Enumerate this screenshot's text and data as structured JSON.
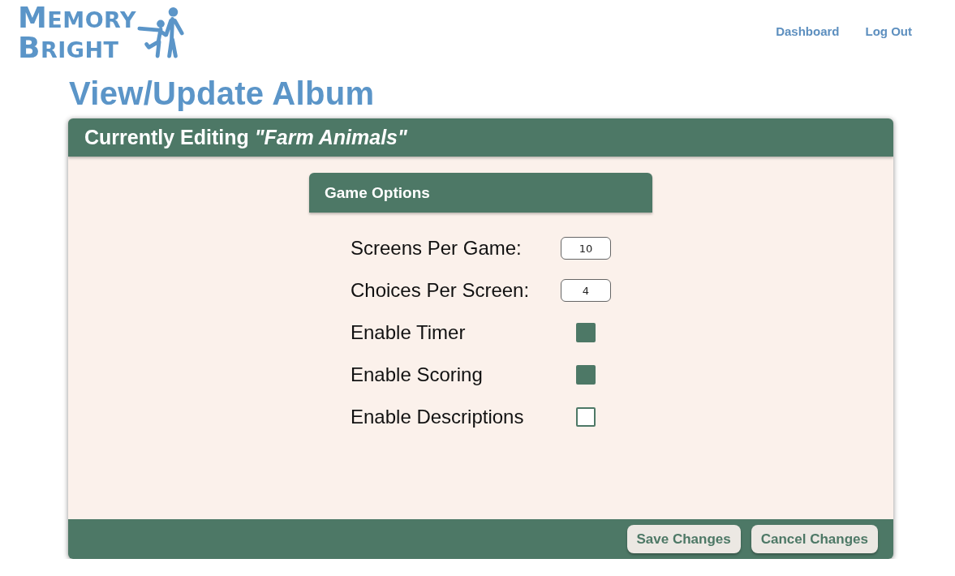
{
  "logo": {
    "lines": [
      "MEMORY",
      "BRIGHT"
    ]
  },
  "nav": [
    "Dashboard",
    "Log Out"
  ],
  "page_title": "View/Update Album",
  "card": {
    "title": "Currently Editing *\"Farm Animals\"*",
    "section": {
      "title": "Game Options",
      "fields": [
        {
          "kind": "number",
          "label": "Screens Per Game:",
          "value": "10"
        },
        {
          "kind": "number",
          "label": "Choices Per Screen:",
          "value": "4"
        },
        {
          "kind": "checkbox",
          "label": "Enable Timer",
          "checked": true
        },
        {
          "kind": "checkbox",
          "label": "Enable Scoring",
          "checked": true
        },
        {
          "kind": "checkbox",
          "label": "Enable Descriptions",
          "checked": false
        }
      ]
    },
    "buttons": [
      "Save Changes",
      "Cancel Changes"
    ]
  }
}
